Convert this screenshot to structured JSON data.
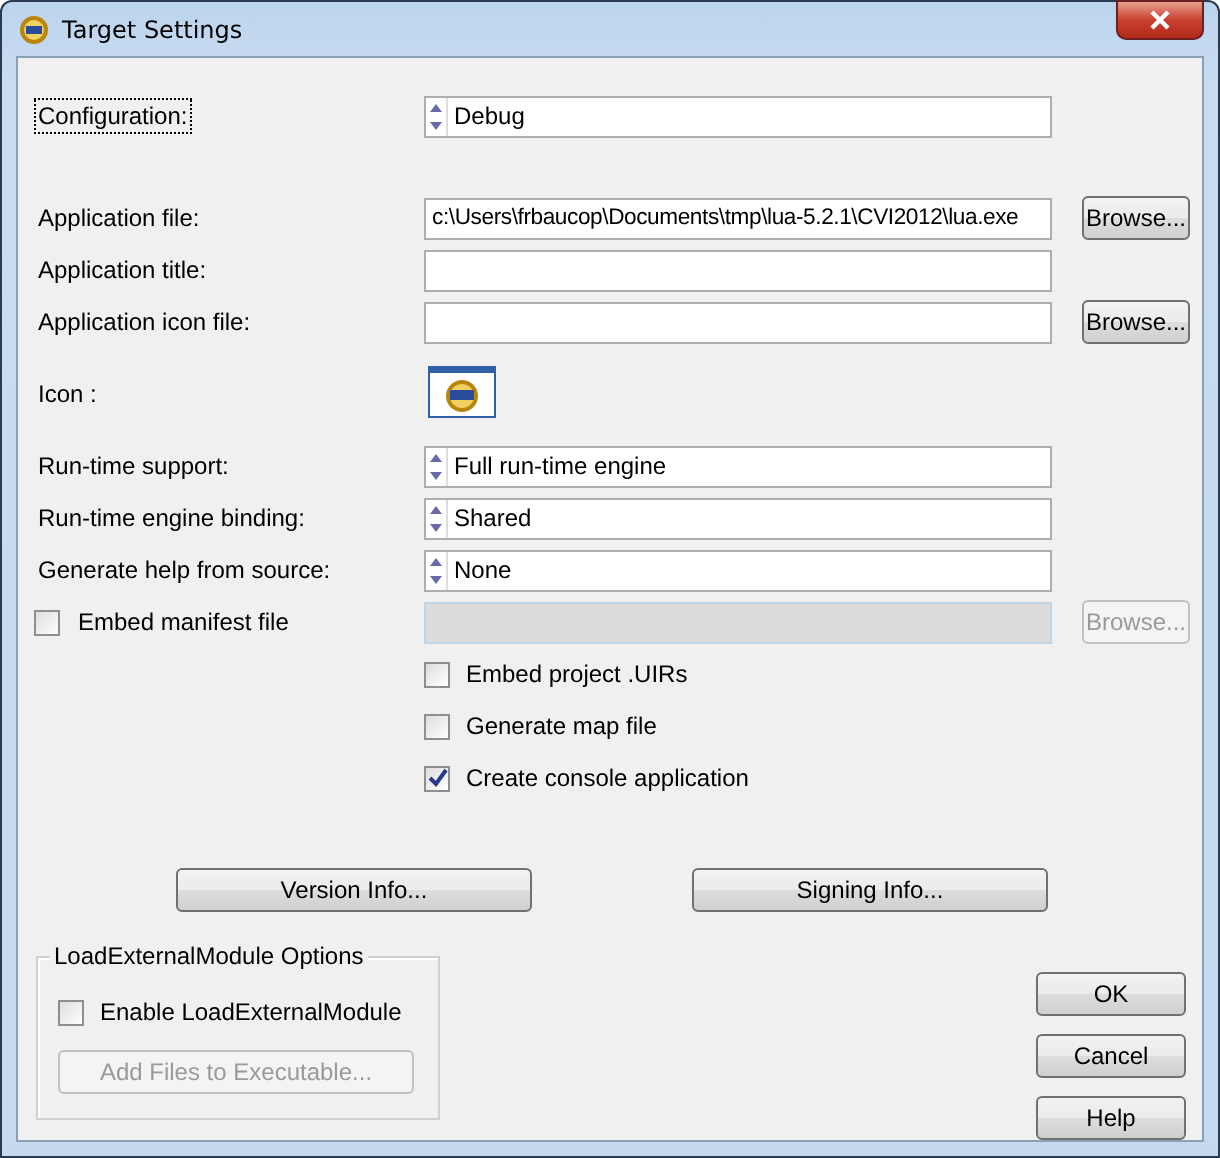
{
  "window": {
    "title": "Target Settings"
  },
  "fields": [
    {
      "kind": "spinner",
      "label": "Configuration:",
      "value": "Debug",
      "focused": true
    },
    {
      "kind": "text",
      "label": "Application file:",
      "value": "c:\\Users\\frbaucop\\Documents\\tmp\\lua-5.2.1\\CVI2012\\lua.exe",
      "browse": {
        "label": "Browse...",
        "disabled": false
      }
    },
    {
      "kind": "text",
      "label": "Application title:"
    },
    {
      "kind": "text",
      "label": "Application icon file:",
      "browse": {
        "label": "Browse...",
        "disabled": false
      }
    },
    {
      "kind": "icon",
      "label": "Icon :"
    },
    {
      "kind": "spinner",
      "label": "Run-time support:",
      "value": "Full run-time engine"
    },
    {
      "kind": "spinner",
      "label": "Run-time engine binding:",
      "value": "Shared"
    },
    {
      "kind": "spinner",
      "label": "Generate help from source:",
      "value": "None"
    },
    {
      "kind": "checkbox",
      "label": "Embed manifest file",
      "checked": false,
      "browse": {
        "label": "Browse...",
        "disabled": true
      }
    }
  ],
  "options": [
    {
      "label": "Embed project .UIRs",
      "checked": false
    },
    {
      "label": "Generate map file",
      "checked": false
    },
    {
      "label": "Create console application",
      "checked": true
    }
  ],
  "info_buttons": [
    "Version Info...",
    "Signing Info..."
  ],
  "group": {
    "title": "LoadExternalModule Options",
    "checkbox": {
      "label": "Enable LoadExternalModule",
      "checked": false
    },
    "button": {
      "label": "Add Files to Executable...",
      "disabled": true
    }
  },
  "dialog_buttons": [
    "OK",
    "Cancel",
    "Help"
  ]
}
